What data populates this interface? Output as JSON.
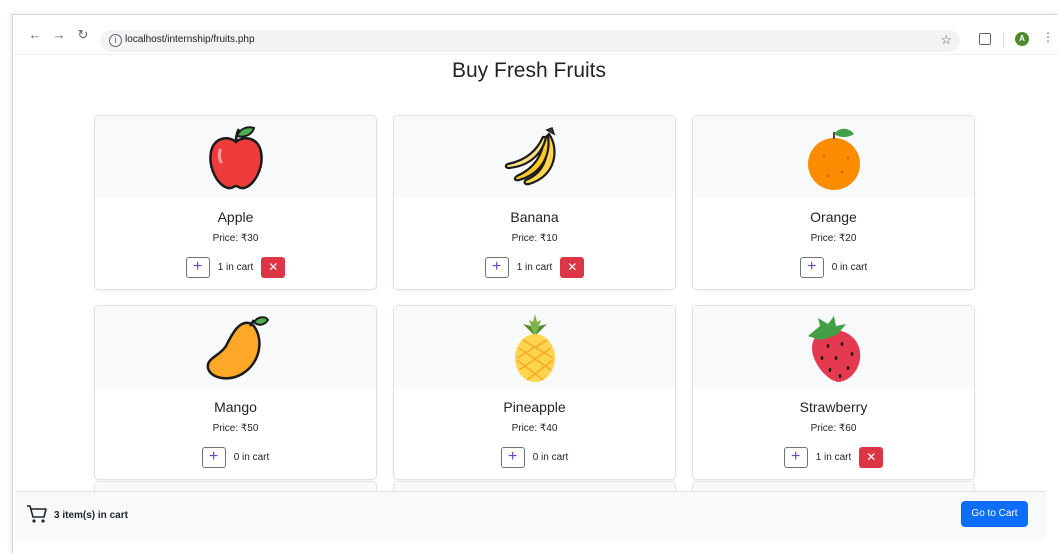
{
  "browser": {
    "url": "localhost/internship/fruits.php",
    "avatar_initial": "A"
  },
  "page": {
    "title": "Buy Fresh Fruits"
  },
  "products": [
    {
      "name": "Apple",
      "price": "Price: ₹30",
      "cart": "1 in cart",
      "icon": "apple-icon"
    },
    {
      "name": "Banana",
      "price": "Price: ₹10",
      "cart": "1 in cart",
      "icon": "banana-icon"
    },
    {
      "name": "Orange",
      "price": "Price: ₹20",
      "cart": "0 in cart",
      "icon": "orange-icon"
    },
    {
      "name": "Mango",
      "price": "Price: ₹50",
      "cart": "0 in cart",
      "icon": "mango-icon"
    },
    {
      "name": "Pineapple",
      "price": "Price: ₹40",
      "cart": "0 in cart",
      "icon": "pineapple-icon"
    },
    {
      "name": "Strawberry",
      "price": "Price: ₹60",
      "cart": "1 in cart",
      "icon": "strawberry-icon"
    }
  ],
  "footer": {
    "cart_summary": "3 item(s) in cart",
    "go_to_cart": "Go to Cart"
  },
  "colors": {
    "primary": "#0d6efd",
    "danger": "#dc3545"
  }
}
